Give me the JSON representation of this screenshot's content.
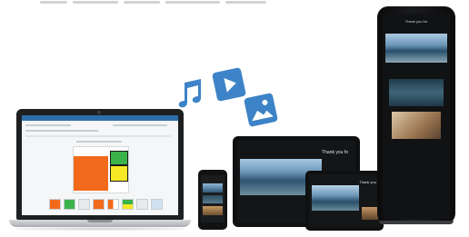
{
  "phone": {
    "title": ""
  },
  "tablet_landscape": {
    "title": "Thank you fo"
  },
  "tablet_small": {
    "title": "Thank you"
  },
  "kiosk": {
    "title": "Thank you for"
  },
  "icons": {
    "music": "music-note-icon",
    "play": "play-icon",
    "image": "image-icon"
  },
  "colors": {
    "icon_blue": "#3d83c7",
    "laptop_bezel": "#1d1f21",
    "orange": "#f26a1b",
    "green": "#3cb34a",
    "yellow": "#f7e826"
  }
}
